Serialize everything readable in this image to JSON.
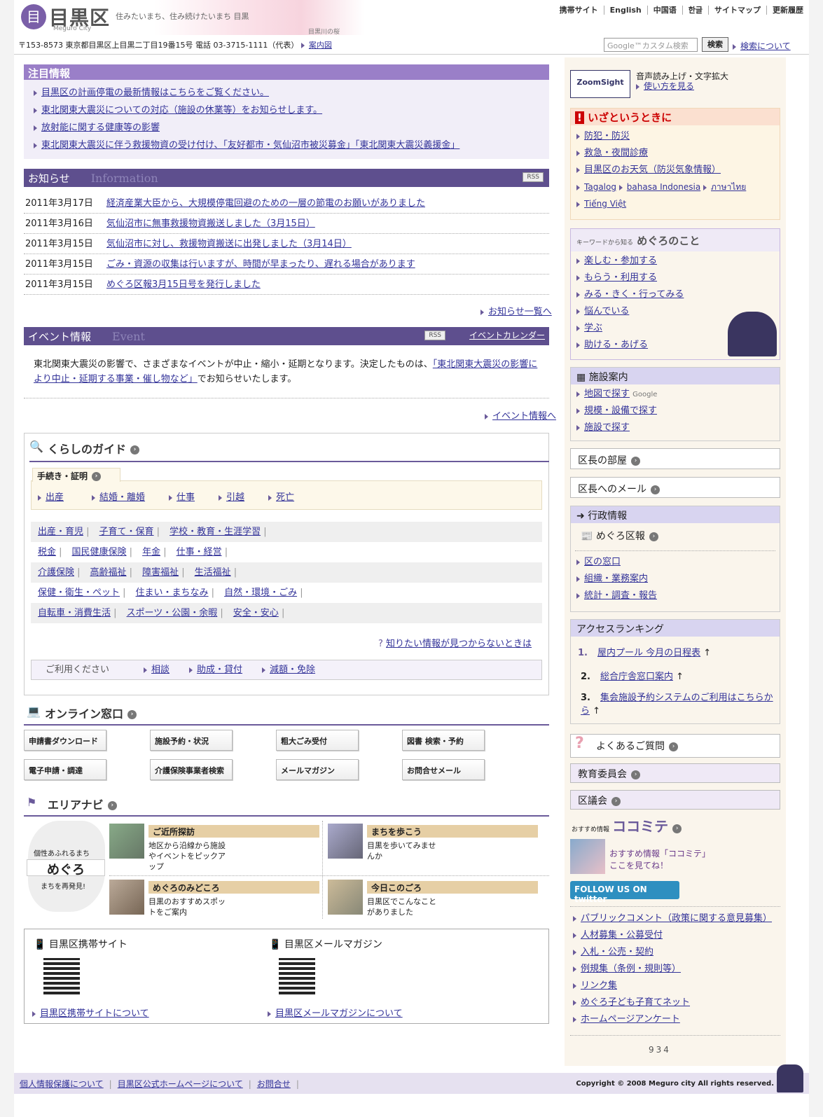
{
  "header": {
    "logo": "目黒区",
    "logo_sub": "Meguro City",
    "tagline": "住みたいまち、住み続けたいまち 目黒",
    "photo_caption": "目黒川の桜",
    "toplinks": [
      "携帯サイト",
      "English",
      "中国语",
      "한글",
      "サイトマップ",
      "更新履歴"
    ],
    "address": "〒153-8573 東京都目黒区上目黒二丁目19番15号 電話 03-3715-1111（代表）",
    "map_link": "案内図",
    "search_placeholder": "Google™カスタム検索",
    "search_button": "検索",
    "search_about": "検索について"
  },
  "chumoku": {
    "title": "注目情報",
    "items": [
      "目黒区の計画停電の最新情報はこちらをご覧ください。",
      "東北関東大震災についての対応（施設の休業等）をお知らせします。",
      "放射能に関する健康等の影響",
      "東北関東大震災に伴う救援物資の受け付け、「友好都市・気仙沼市被災募金」「東北関東大震災義援金」"
    ]
  },
  "news": {
    "title": "お知らせ",
    "title_en": "Information",
    "rss": "RSS",
    "more": "お知らせ一覧へ",
    "rows": [
      {
        "date": "2011年3月17日",
        "text": "経済産業大臣から、大規模停電回避のための一層の節電のお願いがありました"
      },
      {
        "date": "2011年3月16日",
        "text": "気仙沼市に無事救援物資搬送しました（3月15日）"
      },
      {
        "date": "2011年3月15日",
        "text": "気仙沼市に対し、救援物資搬送に出発しました（3月14日）"
      },
      {
        "date": "2011年3月15日",
        "text": "ごみ・資源の収集は行いますが、時間が早まったり、遅れる場合があります"
      },
      {
        "date": "2011年3月15日",
        "text": "めぐろ区報3月15日号を発行しました"
      }
    ]
  },
  "event": {
    "title": "イベント情報",
    "title_en": "Event",
    "rss": "RSS",
    "calendar": "イベントカレンダー",
    "text1": "東北関東大震災の影響で、さまざまなイベントが中止・縮小・延期となります。決定したものは、",
    "link": "「東北関東大震災の影響により中止・延期する事業・催し物など」",
    "text2": "でお知らせいたします。",
    "more": "イベント情報へ"
  },
  "kurashi": {
    "title": "くらしのガイド",
    "tab": "手続き・証明",
    "procs": [
      "出産",
      "結婚・離婚",
      "仕事",
      "引越",
      "死亡"
    ],
    "rows": [
      [
        "出産・育児",
        "子育て・保育",
        "学校・教育・生涯学習"
      ],
      [
        "税金",
        "国民健康保険",
        "年金",
        "仕事・経営"
      ],
      [
        "介護保険",
        "高齢福祉",
        "障害福祉",
        "生活福祉"
      ],
      [
        "保健・衛生・ペット",
        "住まい・まちなみ",
        "自然・環境・ごみ"
      ],
      [
        "自転車・消費生活",
        "スポーツ・公園・余暇",
        "安全・安心"
      ]
    ],
    "notfound": "知りたい情報が見つからないときは",
    "riyou_label": "ご利用ください",
    "riyou": [
      "相談",
      "助成・貸付",
      "減額・免除"
    ]
  },
  "online": {
    "title": "オンライン窓口",
    "buttons": [
      "申請書ダウンロード",
      "施設予約・状況",
      "粗大ごみ受付",
      "図書 検索・予約",
      "電子申請・調達",
      "介護保険事業者検索",
      "メールマガジン",
      "お問合せメール"
    ]
  },
  "area": {
    "title": "エリアナビ",
    "side1": "個性あふれるまち",
    "side2": "めぐろ",
    "side3": "まちを再発見!",
    "items": [
      {
        "t": "ご近所探訪",
        "d": "地区から沿線から施設やイベントをピックアップ"
      },
      {
        "t": "まちを歩こう",
        "d": "目黒を歩いてみませんか"
      },
      {
        "t": "めぐろのみどころ",
        "d": "目黒のおすすめスポットをご案内"
      },
      {
        "t": "今日このごろ",
        "d": "目黒区でこんなことがありました"
      }
    ]
  },
  "mobile": {
    "t1": "目黒区携帯サイト",
    "t2": "目黒区メールマガジン",
    "l1": "目黒区携帯サイトについて",
    "l2": "目黒区メールマガジンについて"
  },
  "right": {
    "zoom_l1": "音声読み上げ・文字拡大",
    "zoom_l2": "使い方を見る",
    "zoom_logo": "ZoomSight",
    "emergency": "いざというときに",
    "emergency_items": [
      "防犯・防災",
      "救急・夜間診療",
      "目黒区のお天気（防災気象情報）"
    ],
    "langs": [
      "Tagalog",
      "bahasa Indonesia",
      "ภาษาไทย",
      "Tiếng Việt"
    ],
    "keyword_tag": "キーワードから知る",
    "keyword": "めぐろのこと",
    "keyword_items": [
      "楽しむ・参加する",
      "もらう・利用する",
      "みる・きく・行ってみる",
      "悩んでいる",
      "学ぶ",
      "助ける・あげる"
    ],
    "facility": "施設案内",
    "facility_items": [
      "地図で探す",
      "規模・設備で探す",
      "施設で探す"
    ],
    "google": "Google",
    "mayor_room": "区長の部屋",
    "mayor_mail": "区長へのメール",
    "gyosei": "行政情報",
    "kuho": "めぐろ区報",
    "gyosei_items": [
      "区の窓口",
      "組織・業務案内",
      "統計・調査・報告"
    ],
    "ranking": "アクセスランキング",
    "rank_items": [
      {
        "n": "1.",
        "t": "屋内プール 今月の日程表"
      },
      {
        "n": "2.",
        "t": "総合庁舎窓口案内"
      },
      {
        "n": "3.",
        "t": "集会施設予約システムのご利用はこちらから"
      }
    ],
    "faq": "よくあるご質問",
    "kyoiku": "教育委員会",
    "kugikai": "区議会",
    "cocomite_tag": "おすすめ情報",
    "cocomite": "ココミテ",
    "cocomite_desc": "おすすめ情報「ココミテ」ここを見てね！",
    "twitter": "FOLLOW US ON twitter",
    "links": [
      "パブリックコメント（政策に関する意見募集）",
      "人材募集・公募受付",
      "入札・公売・契約",
      "例規集（条例・規則等）",
      "リンク集",
      "めぐろ子ども子育てネット",
      "ホームページアンケート"
    ],
    "counter": "934"
  },
  "footer": {
    "links": [
      "個人情報保護について",
      "目黒区公式ホームページについて",
      "お問合せ"
    ],
    "copyright": "Copyright © 2008 Meguro city All rights reserved."
  }
}
